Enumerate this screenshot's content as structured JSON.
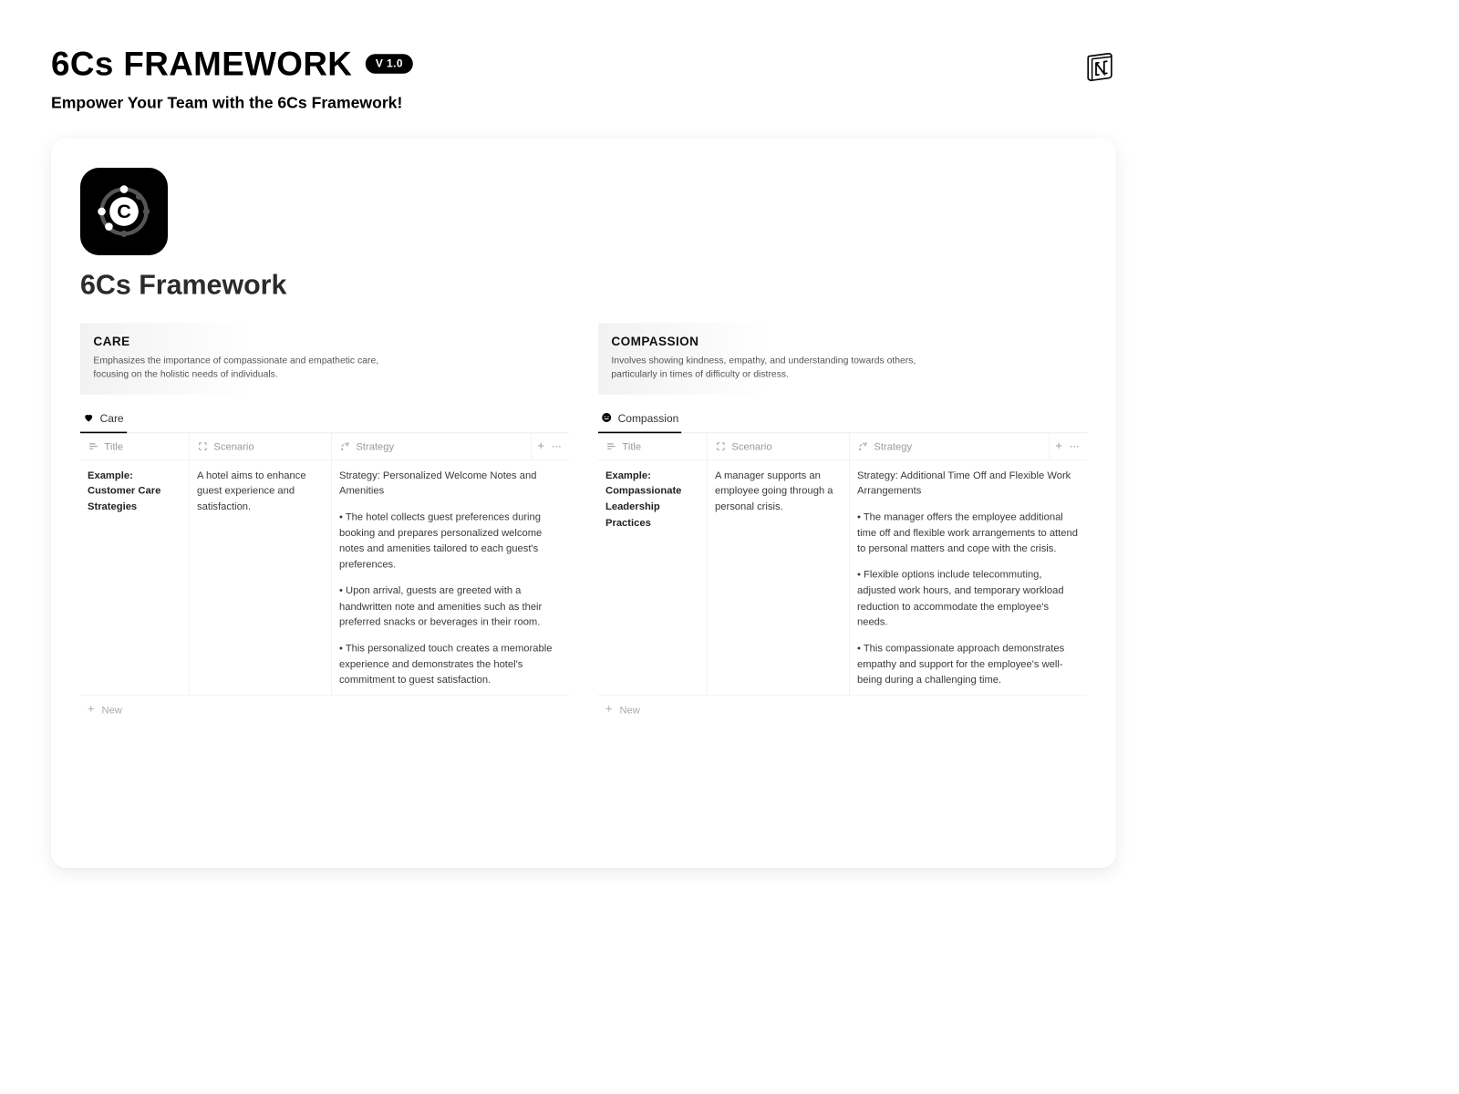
{
  "header": {
    "title": "6Cs FRAMEWORK",
    "version": "V 1.0",
    "subtitle": "Empower Your Team with the 6Cs Framework!"
  },
  "page": {
    "title": "6Cs Framework"
  },
  "sections": [
    {
      "key": "care",
      "heading": "CARE",
      "description": "Emphasizes the importance of compassionate and empathetic care, focusing on the holistic needs of individuals.",
      "tab_label": "Care",
      "tab_icon": "heart-icon",
      "columns": {
        "title": "Title",
        "scenario": "Scenario",
        "strategy": "Strategy"
      },
      "row": {
        "title": "Example: Customer Care Strategies",
        "scenario": "A hotel aims to enhance guest experience and satisfaction.",
        "strategy": [
          "Strategy: Personalized Welcome Notes and Amenities",
          "• The hotel collects guest preferences during booking and prepares personalized welcome notes and amenities tailored to each guest's preferences.",
          "• Upon arrival, guests are greeted with a handwritten note and amenities such as their preferred snacks or beverages in their room.",
          "• This personalized touch creates a memorable experience and demonstrates the hotel's commitment to guest satisfaction."
        ]
      },
      "new_label": "New"
    },
    {
      "key": "compassion",
      "heading": "COMPASSION",
      "description": "Involves showing kindness, empathy, and understanding towards others, particularly in times of difficulty or distress.",
      "tab_label": "Compassion",
      "tab_icon": "face-icon",
      "columns": {
        "title": "Title",
        "scenario": "Scenario",
        "strategy": "Strategy"
      },
      "row": {
        "title": "Example: Compassionate Leadership Practices",
        "scenario": "A manager supports an employee going through a personal crisis.",
        "strategy": [
          "Strategy: Additional Time Off and Flexible Work Arrangements",
          "• The manager offers the employee additional time off and flexible work arrangements to attend to personal matters and cope with the crisis.",
          "• Flexible options include telecommuting, adjusted work hours, and temporary workload reduction to accommodate the employee's needs.",
          "• This compassionate approach demonstrates empathy and support for the employee's well-being during a challenging time."
        ]
      },
      "new_label": "New"
    }
  ]
}
